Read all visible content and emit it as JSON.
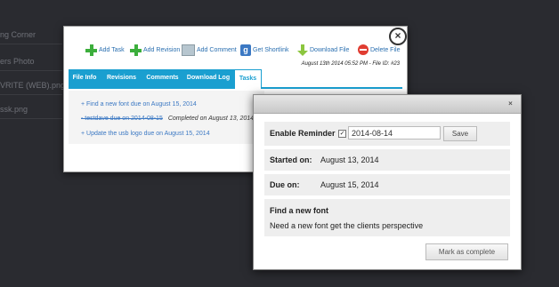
{
  "background": {
    "items": [
      "ng Corner",
      "ers Photo",
      "VRITE (WEB).png",
      "ssk.png"
    ]
  },
  "file_modal": {
    "toolbar": {
      "add_task": "Add Task",
      "add_revision": "Add Revision",
      "add_comment": "Add Comment",
      "get_shortlink": "Get Shortlink",
      "download_file": "Download File",
      "delete_file": "Delete File"
    },
    "meta": "August 13th 2014 05:52 PM - File ID: #23",
    "tabs": [
      "File Info",
      "Revisions",
      "Comments",
      "Download Log",
      "Tasks"
    ],
    "active_tab": "Tasks",
    "tasks": [
      {
        "text": "+ Find a new font due on August 15, 2014"
      },
      {
        "text": "- testdave due on 2014-08-15",
        "completed": "Completed on August 13, 2014"
      },
      {
        "text": "+ Update the usb logo due on August 15, 2014"
      }
    ]
  },
  "task_modal": {
    "enable_reminder_label": "Enable Reminder",
    "reminder_checked": true,
    "reminder_date": "2014-08-14",
    "save_label": "Save",
    "started_label": "Started on:",
    "started_value": "August 13, 2014",
    "due_label": "Due on:",
    "due_value": "August 15, 2014",
    "title": "Find a new font",
    "description": "Need a new font get the clients perspective",
    "mark_complete_label": "Mark as complete"
  },
  "colors": {
    "tab_blue": "#1a9fd0",
    "link_blue": "#3b78c3",
    "plus_green": "#3cae3c"
  }
}
